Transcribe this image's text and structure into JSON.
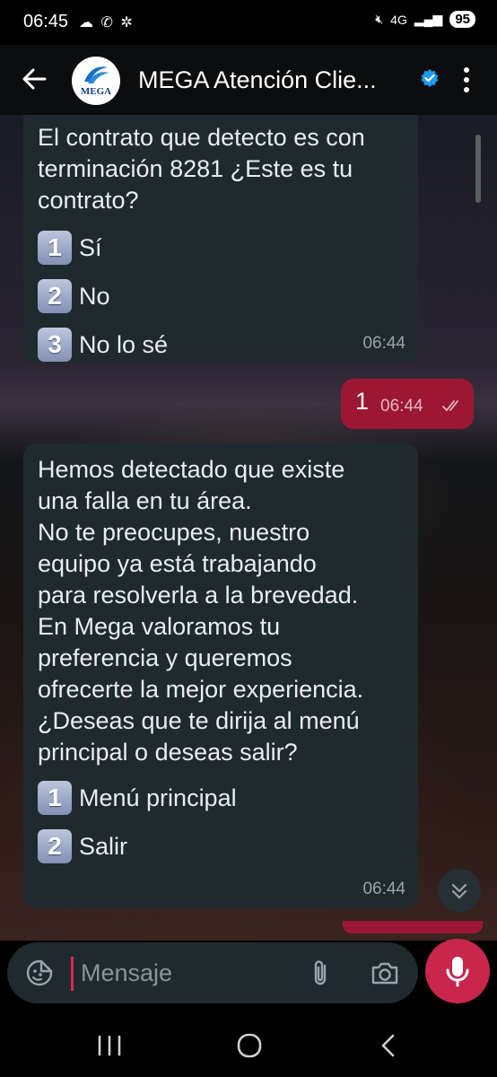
{
  "status_bar": {
    "time": "06:45",
    "left_icons": [
      "cloud-icon",
      "whatsapp-icon",
      "pinwheel-icon"
    ],
    "network": "4G",
    "battery": "95"
  },
  "header": {
    "avatar_text": "MEGA",
    "title": "MEGA Atención Clie...",
    "verified_color": "#1d9bf0"
  },
  "messages": [
    {
      "direction": "in",
      "text": "El contrato que detecto es con\nterminación 8281 ¿Este es tu\ncontrato?",
      "options": [
        {
          "num": "1",
          "label": "Sí"
        },
        {
          "num": "2",
          "label": "No"
        },
        {
          "num": "3",
          "label": "No lo sé"
        }
      ],
      "time": "06:44"
    },
    {
      "direction": "out",
      "text": "1",
      "time": "06:44",
      "ticks": "read"
    },
    {
      "direction": "in",
      "text": "Hemos detectado que existe\nuna falla en tu área.\nNo te preocupes, nuestro\nequipo ya está trabajando\npara resolverla a la brevedad.\nEn Mega valoramos tu\npreferencia y queremos\nofrecerte la mejor experiencia.\n¿Deseas que te dirija al menú\nprincipal o deseas salir?\n",
      "options": [
        {
          "num": "1",
          "label": "Menú principal"
        },
        {
          "num": "2",
          "label": "Salir"
        }
      ],
      "time": "06:44"
    }
  ],
  "composer": {
    "placeholder": "Mensaje"
  },
  "colors": {
    "incoming_bubble": "#1f2a2e",
    "outgoing_bubble": "#9b1734",
    "mic_button": "#c8264c"
  }
}
